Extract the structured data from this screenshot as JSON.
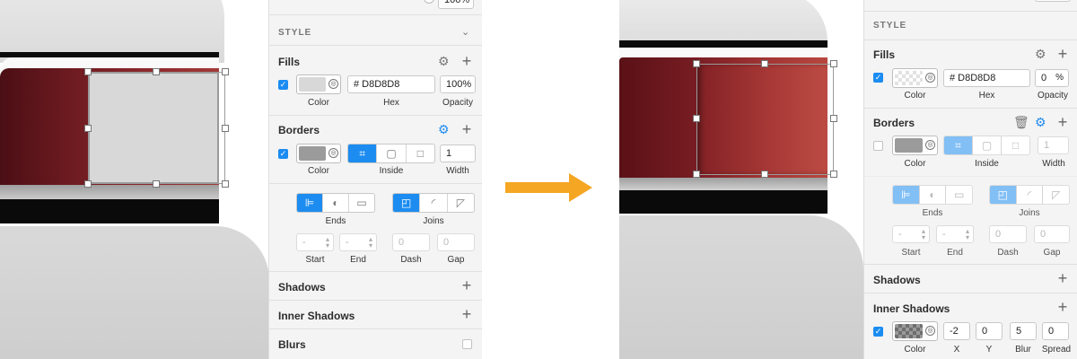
{
  "colors": {
    "accent": "#1c8cf0",
    "arrow": "#f5a623",
    "fill_gray": "#d8d8d8",
    "maroon": "#6e1a1f"
  },
  "left_panel": {
    "top_field": "100%",
    "style_heading": "STYLE",
    "fills": {
      "title": "Fills",
      "hex": "# D8D8D8",
      "opacity": "100%",
      "labels": {
        "color": "Color",
        "hex": "Hex",
        "opacity": "Opacity"
      }
    },
    "borders": {
      "title": "Borders",
      "width": "1",
      "labels": {
        "color": "Color",
        "position": "Inside",
        "width": "Width"
      }
    },
    "line_options": {
      "ends_label": "Ends",
      "joins_label": "Joins",
      "start_value": "-",
      "end_value": "-",
      "dash_value": "0",
      "gap_value": "0",
      "labels": {
        "start": "Start",
        "end": "End",
        "dash": "Dash",
        "gap": "Gap"
      }
    },
    "shadows": "Shadows",
    "inner_shadows": "Inner Shadows",
    "blurs": "Blurs"
  },
  "right_panel": {
    "style_heading": "STYLE",
    "fills": {
      "title": "Fills",
      "hex": "# D8D8D8",
      "opacity": "0",
      "opacity_unit": "%",
      "labels": {
        "color": "Color",
        "hex": "Hex",
        "opacity": "Opacity"
      }
    },
    "borders": {
      "title": "Borders",
      "width": "1",
      "labels": {
        "color": "Color",
        "position": "Inside",
        "width": "Width"
      }
    },
    "line_options": {
      "ends_label": "Ends",
      "joins_label": "Joins",
      "start_value": "-",
      "end_value": "-",
      "dash_value": "0",
      "gap_value": "0",
      "labels": {
        "start": "Start",
        "end": "End",
        "dash": "Dash",
        "gap": "Gap"
      }
    },
    "shadows": "Shadows",
    "inner_shadows": {
      "title": "Inner Shadows",
      "x": "-2",
      "y": "0",
      "blur": "5",
      "spread": "0",
      "labels": {
        "color": "Color",
        "x": "X",
        "y": "Y",
        "blur": "Blur",
        "spread": "Spread"
      }
    }
  },
  "icons": {
    "gear": "gear-icon",
    "plus": "plus-icon",
    "trash": "trash-icon",
    "chevron": "chevron-down-icon",
    "checkmark": "checkmark-icon",
    "arrow": "right-arrow-icon"
  }
}
